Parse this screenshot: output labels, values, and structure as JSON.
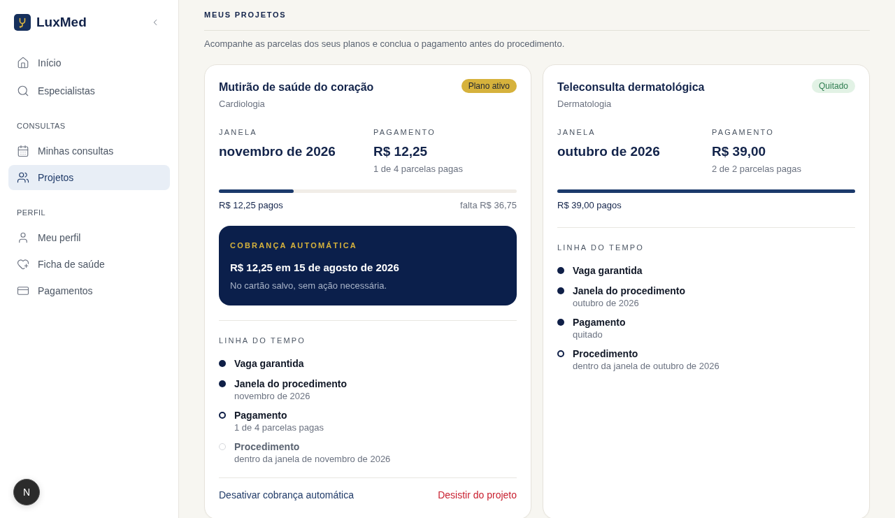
{
  "sidebar": {
    "brand": "LuxMed",
    "groups": [
      {
        "items": [
          {
            "label": "Início",
            "selected": false
          },
          {
            "label": "Especialistas",
            "selected": false
          }
        ]
      },
      {
        "heading": "CONSULTAS",
        "items": [
          {
            "label": "Minhas consultas",
            "selected": false
          },
          {
            "label": "Projetos",
            "selected": true
          }
        ]
      },
      {
        "heading": "PERFIL",
        "items": [
          {
            "label": "Meu perfil",
            "selected": false
          },
          {
            "label": "Ficha de saúde",
            "selected": false
          },
          {
            "label": "Pagamentos",
            "selected": false
          }
        ]
      }
    ]
  },
  "dev_badge": {
    "label": "N"
  },
  "page": {
    "heading": "MEUS PROJETOS",
    "description": "Acompanhe as parcelas dos seus planos e conclua o pagamento antes do procedimento."
  },
  "projects": [
    {
      "title": "Mutirão de saúde do coração",
      "specialty": "Cardiologia",
      "badge": {
        "label": "Plano ativo",
        "kind": "active"
      },
      "stats": [
        {
          "label": "JANELA",
          "value": "novembro de 2026"
        },
        {
          "label": "PAGAMENTO",
          "value": "R$ 12,25",
          "note": "1 de 4 parcelas pagas"
        }
      ],
      "progress": {
        "level": 0.25,
        "paid": "R$ 12,25 pagos",
        "remaining": "falta R$ 36,75"
      },
      "autopay": {
        "label": "COBRANÇA AUTOMÁTICA",
        "amount": "R$ 12,25 em 15 de agosto de 2026",
        "note": "No cartão salvo, sem ação necessária."
      },
      "timeline": {
        "title": "LINHA DO TEMPO",
        "steps": [
          {
            "label": "Vaga garantida",
            "completed": true,
            "current": false
          },
          {
            "label": "Janela do procedimento",
            "detail": "novembro de 2026",
            "completed": true,
            "current": false
          },
          {
            "label": "Pagamento",
            "detail": "1 de 4 parcelas pagas",
            "completed": false,
            "current": true
          },
          {
            "label": "Procedimento",
            "detail": "dentro da janela de novembro de 2026",
            "completed": false,
            "current": false
          }
        ]
      },
      "actions": [
        {
          "label": "Desativar cobrança automática",
          "kind": "neutral"
        },
        {
          "label": "Desistir do projeto",
          "kind": "danger"
        }
      ]
    },
    {
      "title": "Teleconsulta dermatológica",
      "specialty": "Dermatologia",
      "badge": {
        "label": "Quitado",
        "kind": "paid"
      },
      "stats": [
        {
          "label": "JANELA",
          "value": "outubro de 2026"
        },
        {
          "label": "PAGAMENTO",
          "value": "R$ 39,00",
          "note": "2 de 2 parcelas pagas"
        }
      ],
      "progress": {
        "level": 1,
        "paid": "R$ 39,00 pagos"
      },
      "timeline": {
        "title": "LINHA DO TEMPO",
        "steps": [
          {
            "label": "Vaga garantida",
            "completed": true,
            "current": false
          },
          {
            "label": "Janela do procedimento",
            "detail": "outubro de 2026",
            "completed": true,
            "current": false
          },
          {
            "label": "Pagamento",
            "detail": "quitado",
            "completed": true,
            "current": false
          },
          {
            "label": "Procedimento",
            "detail": "dentro da janela de outubro de 2026",
            "completed": false,
            "current": true
          }
        ]
      }
    }
  ]
}
